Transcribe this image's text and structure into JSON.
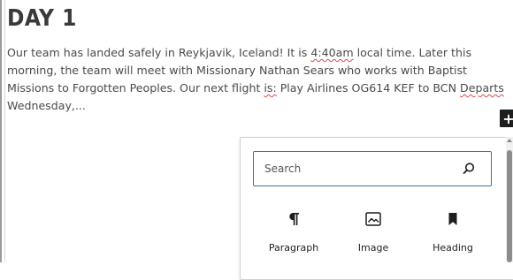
{
  "post": {
    "title": "DAY 1",
    "paragraph": {
      "t1": "Our team has landed safely in Reykjavik, Iceland! It is ",
      "s1": "4:40am",
      "t2": " local time. Later this morning, the team will meet with Missionary Nathan Sears who works with Baptist Missions to Forgotten Peoples. Our next flight ",
      "s2": "is:",
      "t3": " Play Airlines OG614 KEF to BCN ",
      "s3": "Departs",
      "t4": " Wednesday,..."
    }
  },
  "toolbar": {
    "add_block_label": "+"
  },
  "inserter": {
    "search_placeholder": "Search",
    "search_value": "",
    "blocks": [
      {
        "label": "Paragraph",
        "icon": "paragraph-icon"
      },
      {
        "label": "Image",
        "icon": "image-icon"
      },
      {
        "label": "Heading",
        "icon": "heading-icon"
      }
    ]
  }
}
